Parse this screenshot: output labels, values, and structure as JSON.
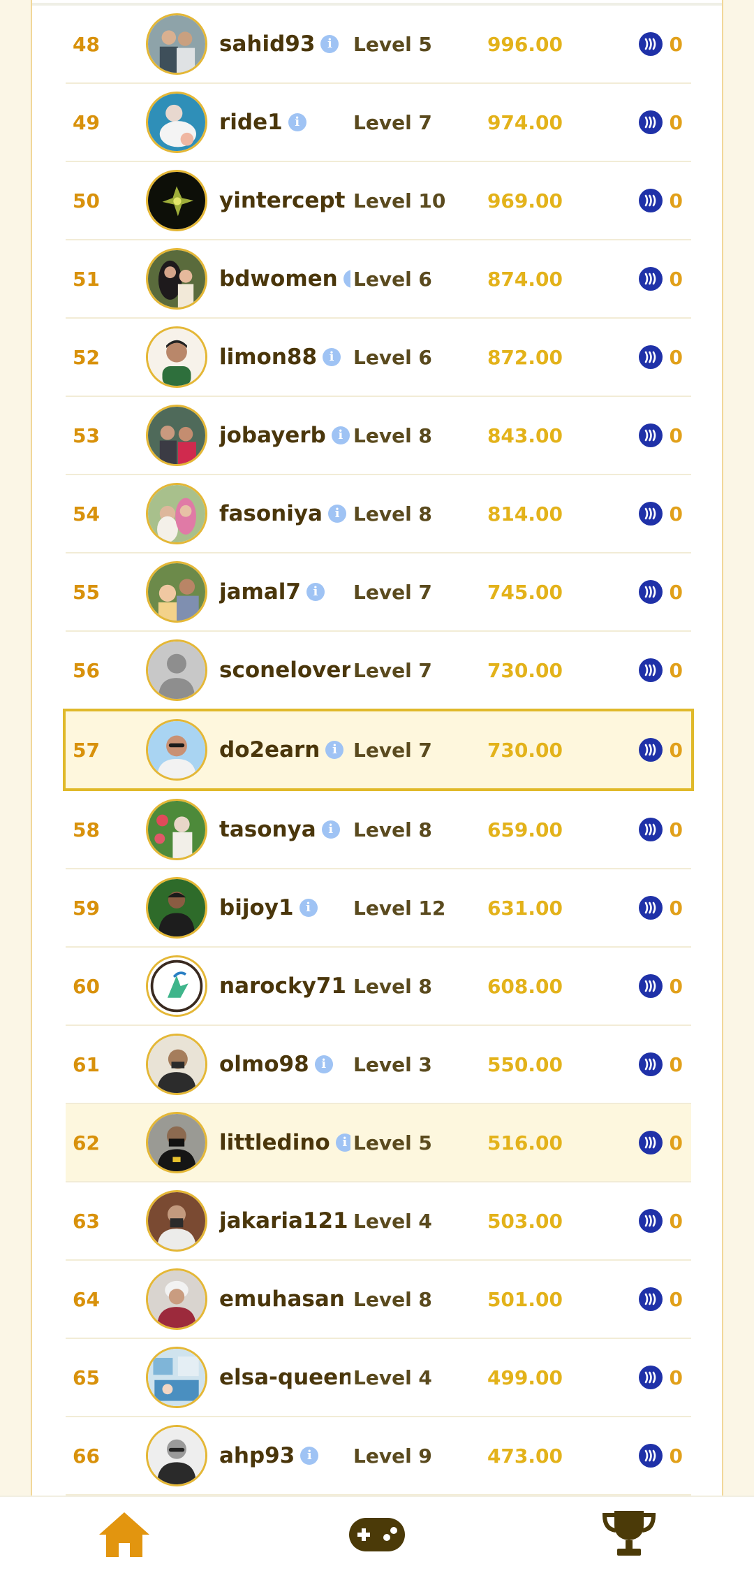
{
  "rows": [
    {
      "rank": "48",
      "name": "sahid93",
      "level": "Level 5",
      "points": "996.00",
      "reward": "0"
    },
    {
      "rank": "49",
      "name": "ride1",
      "level": "Level 7",
      "points": "974.00",
      "reward": "0"
    },
    {
      "rank": "50",
      "name": "yintercept",
      "level": "Level 10",
      "points": "969.00",
      "reward": "0"
    },
    {
      "rank": "51",
      "name": "bdwomen",
      "level": "Level 6",
      "points": "874.00",
      "reward": "0"
    },
    {
      "rank": "52",
      "name": "limon88",
      "level": "Level 6",
      "points": "872.00",
      "reward": "0"
    },
    {
      "rank": "53",
      "name": "jobayerb",
      "level": "Level 8",
      "points": "843.00",
      "reward": "0"
    },
    {
      "rank": "54",
      "name": "fasoniya",
      "level": "Level 8",
      "points": "814.00",
      "reward": "0"
    },
    {
      "rank": "55",
      "name": "jamal7",
      "level": "Level 7",
      "points": "745.00",
      "reward": "0"
    },
    {
      "rank": "56",
      "name": "sconelover",
      "level": "Level 7",
      "points": "730.00",
      "reward": "0"
    },
    {
      "rank": "57",
      "name": "do2earn",
      "level": "Level 7",
      "points": "730.00",
      "reward": "0"
    },
    {
      "rank": "58",
      "name": "tasonya",
      "level": "Level 8",
      "points": "659.00",
      "reward": "0"
    },
    {
      "rank": "59",
      "name": "bijoy1",
      "level": "Level 12",
      "points": "631.00",
      "reward": "0"
    },
    {
      "rank": "60",
      "name": "narocky71",
      "level": "Level 8",
      "points": "608.00",
      "reward": "0"
    },
    {
      "rank": "61",
      "name": "olmo98",
      "level": "Level 3",
      "points": "550.00",
      "reward": "0"
    },
    {
      "rank": "62",
      "name": "littledino",
      "level": "Level 5",
      "points": "516.00",
      "reward": "0"
    },
    {
      "rank": "63",
      "name": "jakaria121",
      "level": "Level 4",
      "points": "503.00",
      "reward": "0"
    },
    {
      "rank": "64",
      "name": "emuhasan",
      "level": "Level 8",
      "points": "501.00",
      "reward": "0"
    },
    {
      "rank": "65",
      "name": "elsa-queen",
      "level": "Level 4",
      "points": "499.00",
      "reward": "0"
    },
    {
      "rank": "66",
      "name": "ahp93",
      "level": "Level 9",
      "points": "473.00",
      "reward": "0"
    }
  ],
  "info_icon_glyph": "i",
  "icons": {
    "info": "info-icon",
    "reward": "steem-icon",
    "nav_home": "home-icon",
    "nav_games": "gamepad-icon",
    "nav_leaderboard": "trophy-icon"
  },
  "colors": {
    "rank": "#d8910b",
    "username": "#4a360b",
    "points": "#e3b21a",
    "highlight_border": "#e0b92a",
    "steem_badge": "#1f31a8",
    "nav_icon_active": "#e2950f",
    "nav_icon_dark": "#4b3a08"
  }
}
